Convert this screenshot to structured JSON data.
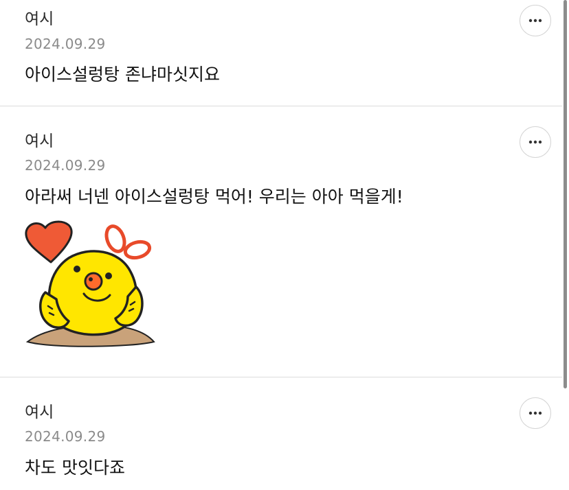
{
  "comments": [
    {
      "author": "여시",
      "date": "2024.09.29",
      "text": "아이스설렁탕 존냐마싯지요",
      "more_icon": "more-horizontal-icon"
    },
    {
      "author": "여시",
      "date": "2024.09.29",
      "text": "아라써 너넨 아이스설렁탕 먹어! 우리는 아아 먹을게!",
      "more_icon": "more-horizontal-icon",
      "sticker": "yellow-chick-heart-sticker"
    },
    {
      "author": "여시",
      "date": "2024.09.29",
      "text": "차도 맛잇다죠",
      "more_icon": "more-horizontal-icon"
    }
  ],
  "colors": {
    "text": "#111111",
    "author": "#2b2b2b",
    "date": "#8a8a8a",
    "divider": "#dcdcdc",
    "scrollbar_thumb": "#8c8c8c"
  }
}
